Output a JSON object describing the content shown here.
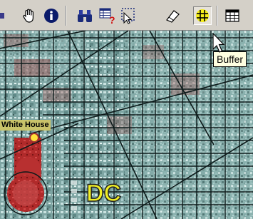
{
  "toolbar": {
    "tools": [
      {
        "name": "pan-tool",
        "icon": "hand-icon"
      },
      {
        "name": "identify-tool",
        "icon": "info-icon"
      },
      {
        "name": "find-tool",
        "icon": "binoculars-icon"
      },
      {
        "name": "query-tool",
        "icon": "query-table-icon"
      },
      {
        "name": "select-tool",
        "icon": "select-pointer-icon"
      },
      {
        "name": "clear-selection-tool",
        "icon": "eraser-icon"
      },
      {
        "name": "buffer-tool",
        "icon": "buffer-icon",
        "active": true
      },
      {
        "name": "attribute-table-tool",
        "icon": "table-icon"
      }
    ]
  },
  "tooltip": {
    "text": "Buffer"
  },
  "map": {
    "labels": {
      "white_house": "White House",
      "dc": "DC"
    },
    "colors": {
      "street_grid": "#0d1a1a",
      "imagery_teal": "#7fa8a6",
      "red_feature": "#b22a2a",
      "label_yellow": "#f1ef25",
      "point_marker": "#ffe23a"
    }
  }
}
